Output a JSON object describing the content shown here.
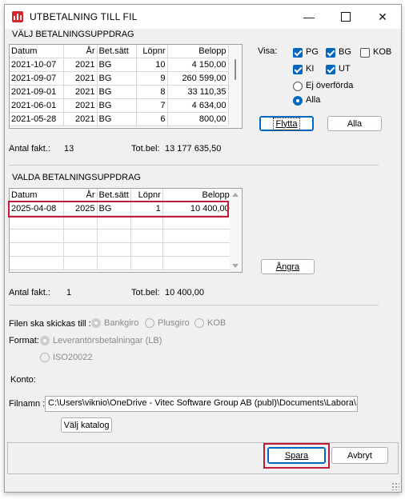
{
  "window": {
    "title": "UTBETALNING TILL FIL"
  },
  "section1": {
    "title": "VÄLJ BETALNINGSUPPDRAG",
    "columns": [
      "Datum",
      "År",
      "Bet.sätt",
      "Löpnr",
      "Belopp"
    ],
    "rows": [
      [
        "2021-10-07",
        "2021",
        "BG",
        "10",
        "4 150,00"
      ],
      [
        "2021-09-07",
        "2021",
        "BG",
        "9",
        "260 599,00"
      ],
      [
        "2021-09-01",
        "2021",
        "BG",
        "8",
        "33 110,35"
      ],
      [
        "2021-06-01",
        "2021",
        "BG",
        "7",
        "4 634,00"
      ],
      [
        "2021-05-28",
        "2021",
        "BG",
        "6",
        "800,00"
      ]
    ],
    "antal_label": "Antal fakt.:",
    "antal_value": "13",
    "totbel_label": "Tot.bel:",
    "totbel_value": "13 177 635,50"
  },
  "visa": {
    "label": "Visa:",
    "checkboxes": [
      {
        "label": "PG",
        "checked": true
      },
      {
        "label": "BG",
        "checked": true
      },
      {
        "label": "KOB",
        "checked": false
      },
      {
        "label": "KI",
        "checked": true
      },
      {
        "label": "UT",
        "checked": true
      }
    ],
    "radios": [
      {
        "label": "Ej överförda",
        "selected": false
      },
      {
        "label": "Alla",
        "selected": true
      }
    ],
    "flytta_label": "Flytta",
    "alla_button_label": "Alla"
  },
  "section2": {
    "title": "VALDA BETALNINGSUPPDRAG",
    "columns": [
      "Datum",
      "År",
      "Bet.sätt",
      "Löpnr",
      "Belopp"
    ],
    "rows": [
      [
        "2025-04-08",
        "2025",
        "BG",
        "1",
        "10 400,00"
      ]
    ],
    "angra_label": "Ångra",
    "antal_label": "Antal fakt.:",
    "antal_value": "1",
    "totbel_label": "Tot.bel:",
    "totbel_value": "10 400,00"
  },
  "export": {
    "send_to_label": "Filen ska skickas till :",
    "send_to_options": [
      "Bankgiro",
      "Plusgiro",
      "KOB"
    ],
    "format_label": "Format:",
    "format_options": [
      "Leverantörsbetalningar (LB)",
      "ISO20022"
    ],
    "konto_label": "Konto:",
    "filnamn_label": "Filnamn :",
    "filnamn_value": "C:\\Users\\viknio\\OneDrive - Vitec Software Group AB (publ)\\Documents\\Labora\\L",
    "valj_katalog_label": "Välj katalog"
  },
  "footer": {
    "spara_label": "Spara",
    "avbryt_label": "Avbryt"
  },
  "colors": {
    "accent": "#0067c0",
    "highlight": "#c11b3b",
    "icon": "#d9262b"
  }
}
